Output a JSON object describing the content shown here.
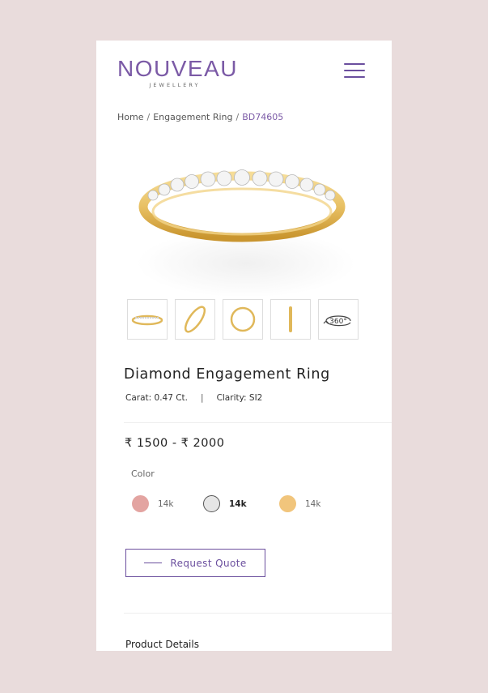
{
  "brand": {
    "name": "NOUVEAU",
    "tagline": "JEWELLERY"
  },
  "breadcrumb": [
    {
      "label": "Home"
    },
    {
      "label": "Engagement Ring"
    },
    {
      "label": "BD74605"
    }
  ],
  "breadcrumb_separator": "/",
  "product": {
    "title": "Diamond Engagement Ring",
    "carat": "Carat: 0.47 Ct.",
    "spec_divider": "|",
    "clarity": "Clarity: SI2",
    "price": "₹ 1500 - ₹ 2000"
  },
  "thumbnails": [
    {
      "name": "front-view"
    },
    {
      "name": "angled-view"
    },
    {
      "name": "top-view"
    },
    {
      "name": "side-view"
    },
    {
      "name": "360-view",
      "label": "360°"
    }
  ],
  "color": {
    "label": "Color",
    "options": [
      {
        "label": "14k",
        "color": "#e3a4a1",
        "selected": false
      },
      {
        "label": "14k",
        "color": "#e6e6e6",
        "selected": true
      },
      {
        "label": "14k",
        "color": "#f1c57c",
        "selected": false
      }
    ]
  },
  "actions": {
    "request_quote": "Request Quote"
  },
  "sections": {
    "product_details": "Product Details"
  },
  "colors": {
    "accent": "#6b4f9e",
    "background": "#e9dcdc",
    "gold": "#e8c063"
  }
}
